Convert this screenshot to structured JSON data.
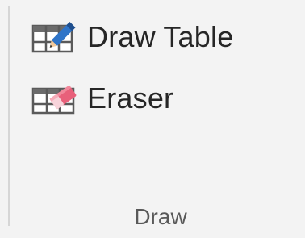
{
  "group": {
    "label": "Draw",
    "commands": [
      {
        "id": "draw-table",
        "label": "Draw Table",
        "icon": "draw-table-icon"
      },
      {
        "id": "eraser",
        "label": "Eraser",
        "icon": "eraser-icon"
      }
    ]
  },
  "colors": {
    "background": "#f3f3f3",
    "text": "#262626",
    "group_label": "#595959",
    "pencil_blue": "#2e74c8",
    "eraser_pink": "#e8607a"
  }
}
